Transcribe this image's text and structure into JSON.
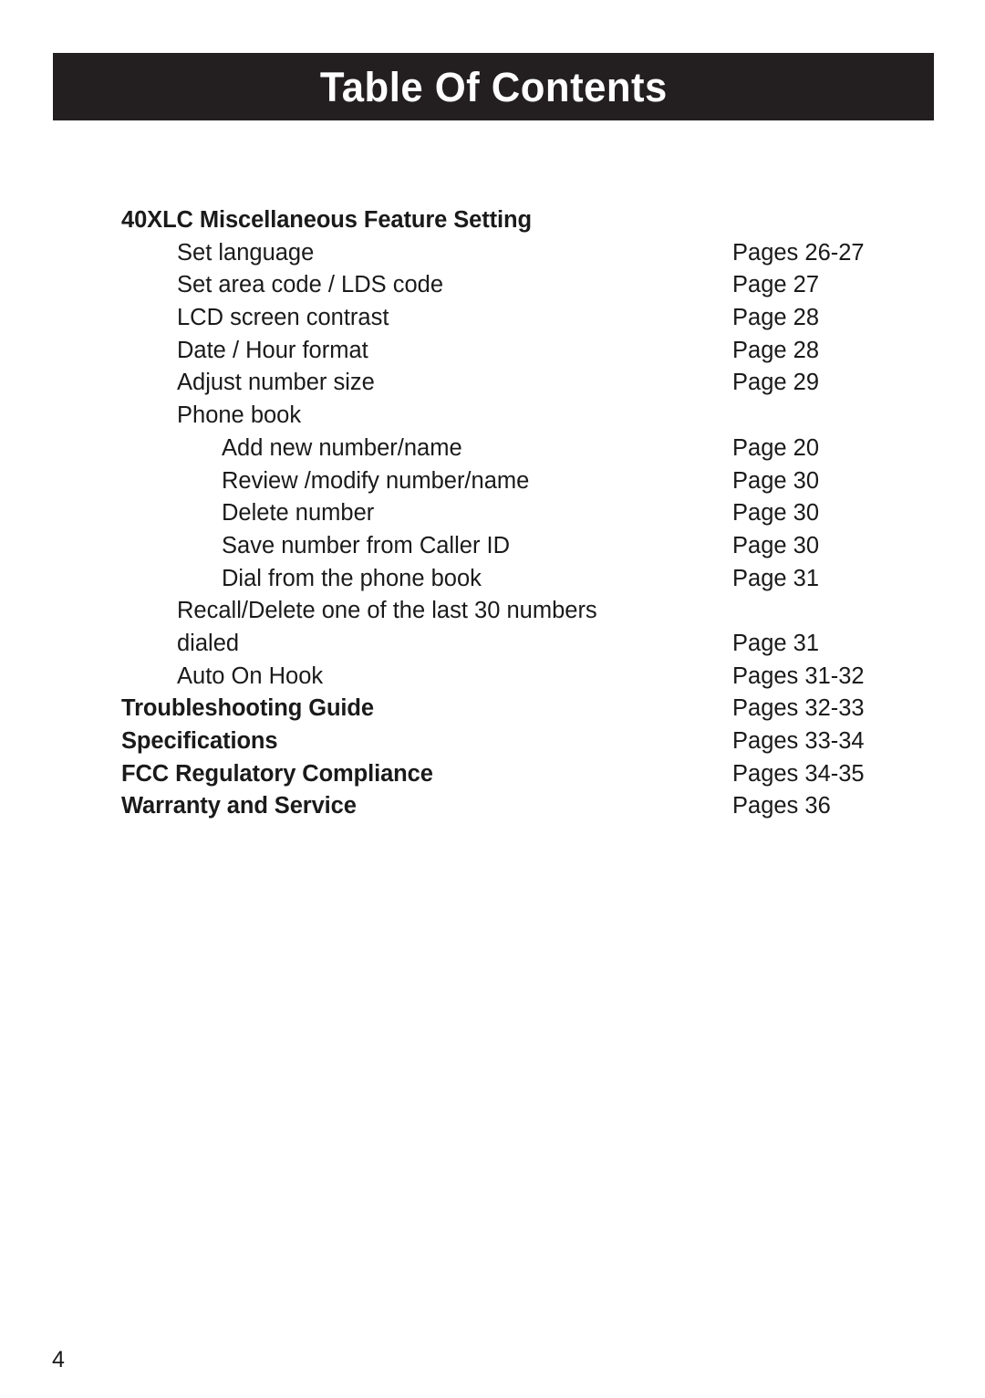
{
  "banner": {
    "title": "Table Of Contents",
    "background_color": "#231f20",
    "text_color": "#ffffff"
  },
  "toc": {
    "rows": [
      {
        "label": "40XLC Miscellaneous Feature Setting",
        "page": "",
        "level": 0,
        "bold": true
      },
      {
        "label": "Set language",
        "page": "Pages 26-27",
        "level": 1,
        "bold": false
      },
      {
        "label": "Set area code / LDS code",
        "page": "Page 27",
        "level": 1,
        "bold": false
      },
      {
        "label": "LCD screen contrast",
        "page": "Page 28",
        "level": 1,
        "bold": false
      },
      {
        "label": "Date / Hour format",
        "page": "Page 28",
        "level": 1,
        "bold": false
      },
      {
        "label": "Adjust number size",
        "page": "Page 29",
        "level": 1,
        "bold": false
      },
      {
        "label": "Phone book",
        "page": "",
        "level": 1,
        "bold": false
      },
      {
        "label": "Add new number/name",
        "page": "Page 20",
        "level": 2,
        "bold": false
      },
      {
        "label": "Review /modify number/name",
        "page": "Page 30",
        "level": 2,
        "bold": false
      },
      {
        "label": "Delete number",
        "page": "Page 30",
        "level": 2,
        "bold": false
      },
      {
        "label": "Save number from Caller ID",
        "page": "Page 30",
        "level": 2,
        "bold": false
      },
      {
        "label": "Dial from the phone book",
        "page": "Page 31",
        "level": 2,
        "bold": false
      },
      {
        "label": "Recall/Delete one of the last 30 numbers",
        "page": "",
        "level": 1,
        "bold": false
      },
      {
        "label": "dialed",
        "page": "Page 31",
        "level": 1,
        "bold": false
      },
      {
        "label": "Auto On Hook",
        "page": "Pages 31-32",
        "level": 1,
        "bold": false
      },
      {
        "label": "Troubleshooting Guide",
        "page": "Pages 32-33",
        "level": 0,
        "bold": true
      },
      {
        "label": "Specifications",
        "page": "Pages 33-34",
        "level": 0,
        "bold": true
      },
      {
        "label": "FCC Regulatory Compliance",
        "page": "Pages 34-35",
        "level": 0,
        "bold": true
      },
      {
        "label": "Warranty and Service",
        "page": "Pages 36",
        "level": 0,
        "bold": true
      }
    ]
  },
  "folio": {
    "page_number": "4"
  }
}
